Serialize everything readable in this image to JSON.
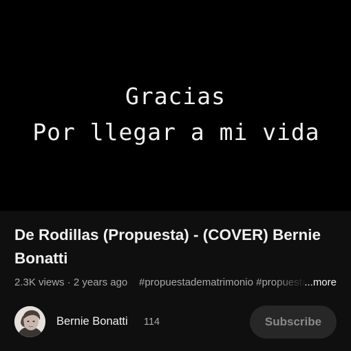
{
  "player": {
    "overlay_line_1": "Gracias",
    "overlay_line_2": "Por llegar a mi vida"
  },
  "video": {
    "title": "De Rodillas (Propuesta) - (COVER) Bernie Bonatti",
    "views": "2.3K views",
    "separator": " · ",
    "age": "2 years ago",
    "hashtags": "#propuestadematrimonio #propuesta",
    "more_label": "...more"
  },
  "channel": {
    "name": "Bernie Bonatti",
    "subscriber_count": "114",
    "avatar_icon": "user-avatar-photo"
  },
  "actions": {
    "subscribe_label": "Subscribe"
  },
  "colors": {
    "background": "#0f0f0f",
    "player_background": "#000000",
    "text_primary": "#f1f1f1",
    "text_secondary": "#aaaaaa",
    "subscribe_bg": "#272727"
  }
}
